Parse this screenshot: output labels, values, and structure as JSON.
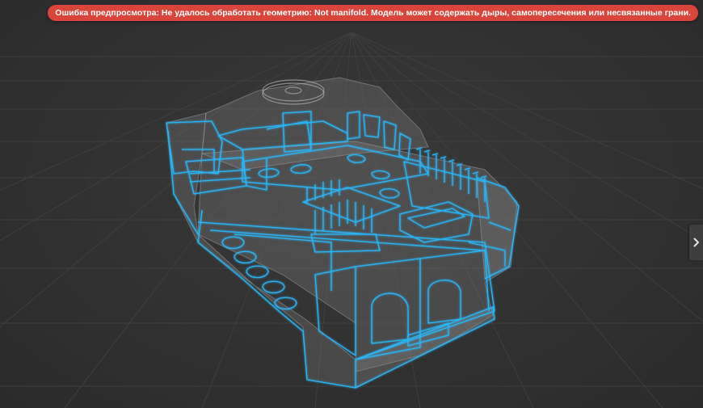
{
  "viewer": {
    "error_message": "Ошибка предпросмотра: Не удалось обработать геометрию: Not manifold. Модель может содержать дыры, самопересечения или несвязанные грани.",
    "side_panel_icon": "chevron-right-icon",
    "colors": {
      "background": "#2f2f2f",
      "grid": "#3d3d3d",
      "wire": "#29b6f6",
      "ghost_body": "#8a8a8a",
      "error": "#d9453b"
    }
  }
}
